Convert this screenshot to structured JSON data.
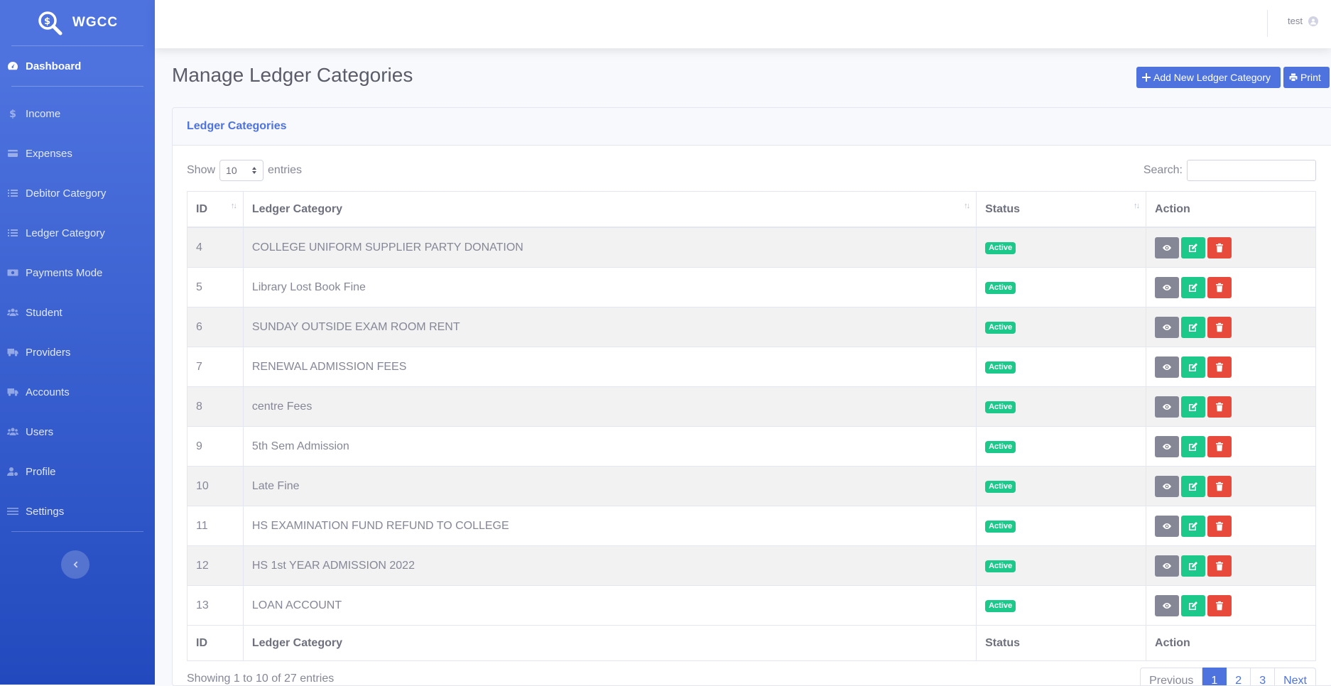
{
  "brand": {
    "name": "WGCC"
  },
  "sidebar": {
    "items": [
      {
        "label": "Dashboard",
        "icon": "tachometer-icon"
      },
      {
        "label": "Income",
        "icon": "dollar-icon"
      },
      {
        "label": "Expenses",
        "icon": "credit-card-icon"
      },
      {
        "label": "Debitor Category",
        "icon": "list-icon"
      },
      {
        "label": "Ledger Category",
        "icon": "list-icon"
      },
      {
        "label": "Payments Mode",
        "icon": "money-bill-icon"
      },
      {
        "label": "Student",
        "icon": "users-icon"
      },
      {
        "label": "Providers",
        "icon": "truck-icon"
      },
      {
        "label": "Accounts",
        "icon": "truck-icon"
      },
      {
        "label": "Users",
        "icon": "users-icon"
      },
      {
        "label": "Profile",
        "icon": "user-cog-icon"
      },
      {
        "label": "Settings",
        "icon": "sliders-icon"
      }
    ]
  },
  "topbar": {
    "username": "test"
  },
  "page": {
    "title": "Manage Ledger Categories",
    "add_button": "Add New Ledger Category",
    "print_button": "Print"
  },
  "card": {
    "title": "Ledger Categories"
  },
  "controls": {
    "show_label": "Show",
    "entries_value": "10",
    "entries_label": "entries",
    "search_label": "Search:",
    "search_value": ""
  },
  "table": {
    "columns": [
      "ID",
      "Ledger Category",
      "Status",
      "Action"
    ],
    "rows": [
      {
        "id": "4",
        "category": "COLLEGE UNIFORM SUPPLIER PARTY DONATION",
        "status": "Active"
      },
      {
        "id": "5",
        "category": "Library Lost Book Fine",
        "status": "Active"
      },
      {
        "id": "6",
        "category": "SUNDAY OUTSIDE EXAM ROOM RENT",
        "status": "Active"
      },
      {
        "id": "7",
        "category": "RENEWAL ADMISSION FEES",
        "status": "Active"
      },
      {
        "id": "8",
        "category": "centre Fees",
        "status": "Active"
      },
      {
        "id": "9",
        "category": "5th Sem Admission",
        "status": "Active"
      },
      {
        "id": "10",
        "category": "Late Fine",
        "status": "Active"
      },
      {
        "id": "11",
        "category": "HS EXAMINATION FUND REFUND TO COLLEGE",
        "status": "Active"
      },
      {
        "id": "12",
        "category": "HS 1st YEAR ADMISSION 2022",
        "status": "Active"
      },
      {
        "id": "13",
        "category": "LOAN ACCOUNT",
        "status": "Active"
      }
    ]
  },
  "footer": {
    "info": "Showing 1 to 10 of 27 entries",
    "pagination": [
      "Previous",
      "1",
      "2",
      "3",
      "Next"
    ],
    "active_page": "1"
  },
  "colors": {
    "primary": "#4e73df",
    "success": "#1cc88a",
    "danger": "#e74a3b",
    "secondary": "#858796"
  }
}
